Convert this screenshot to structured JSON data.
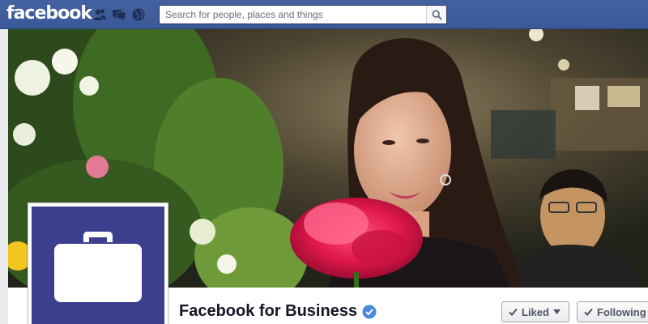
{
  "topbar": {
    "logo": "facebook",
    "brand_color": "#3b5998",
    "jewels": [
      {
        "icon": "friend-requests-icon"
      },
      {
        "icon": "messages-icon"
      },
      {
        "icon": "notifications-globe-icon"
      }
    ]
  },
  "search": {
    "placeholder": "Search for people, places and things",
    "icon": "search-icon"
  },
  "cover": {
    "description_icon": "cover-photo"
  },
  "profile": {
    "icon": "briefcase-icon",
    "bg_color": "#3b3f8e"
  },
  "page": {
    "name": "Facebook for Business",
    "verified_icon": "verified-badge-icon",
    "verified_color": "#4a89dc"
  },
  "actions": {
    "liked_label": "Liked",
    "following_label": "Following"
  }
}
